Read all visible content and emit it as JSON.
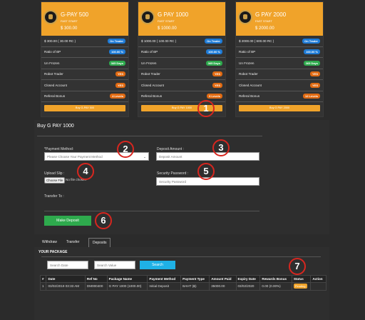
{
  "cards": [
    {
      "title": "G-PAY 500",
      "subtitle": "FAST START",
      "price": "$ 300.00",
      "rows": [
        {
          "label": "$ 300.00 ( 30.00 RC )",
          "badge": "On Trader",
          "color": "b-blue"
        },
        {
          "label": "Ratio of BP",
          "badge": "100.00 %",
          "color": "b-blue"
        },
        {
          "label": "Un Frozen",
          "badge": "365 Days",
          "color": "b-green"
        },
        {
          "label": "Robot Trader",
          "badge": "YES",
          "color": "b-orange"
        },
        {
          "label": "Closed Account",
          "badge": "YES",
          "color": "b-orange"
        },
        {
          "label": "Referal Bonus",
          "badge": "4 Levels",
          "color": "b-orange"
        }
      ],
      "buy": "Buy G-PAY 500"
    },
    {
      "title": "G PAY 1000",
      "subtitle": "FAST START",
      "price": "$ 1000.00",
      "rows": [
        {
          "label": "$ 1000.00 ( 100.00 RC )",
          "badge": "On Trader",
          "color": "b-blue"
        },
        {
          "label": "Ratio of BP",
          "badge": "100.00 %",
          "color": "b-blue"
        },
        {
          "label": "Un Frozen",
          "badge": "365 Days",
          "color": "b-green"
        },
        {
          "label": "Robot Trader",
          "badge": "YES",
          "color": "b-orange"
        },
        {
          "label": "Closed Account",
          "badge": "YES",
          "color": "b-orange"
        },
        {
          "label": "Referal Bonus",
          "badge": "6 Levels",
          "color": "b-orange"
        }
      ],
      "buy": "Buy G PAY 1000"
    },
    {
      "title": "G PAY 2000",
      "subtitle": "FAST START",
      "price": "$ 2000.00",
      "rows": [
        {
          "label": "$ 2000.00 ( 600.00 RC )",
          "badge": "On Trader",
          "color": "b-blue"
        },
        {
          "label": "Ratio of BP",
          "badge": "100.00 %",
          "color": "b-blue"
        },
        {
          "label": "Un Frozen",
          "badge": "365 Days",
          "color": "b-green"
        },
        {
          "label": "Robot Trader",
          "badge": "YES",
          "color": "b-orange"
        },
        {
          "label": "Closed Account",
          "badge": "YES",
          "color": "b-orange"
        },
        {
          "label": "Referal Bonus",
          "badge": "12 Levels",
          "color": "b-orange"
        }
      ],
      "buy": "Buy G PAY 2000"
    }
  ],
  "form": {
    "heading": "Buy G PAY 1000",
    "payment_label": "*Payment Method:",
    "payment_value": "Please Choose Your Payment Method",
    "deposit_label": "Deposit Amount :",
    "deposit_placeholder": "Deposit Amount",
    "upload_label": "Upload Slip :",
    "choose_file": "Choose File",
    "no_file": "No file chosen",
    "security_label": "Security Password :",
    "security_placeholder": "Security Password",
    "transfer_label": "Transfer To :",
    "submit": "Make Deposit"
  },
  "tabs": [
    "Withdraw",
    "Transfer",
    "Deposits"
  ],
  "package": {
    "title": "YOUR PACKAGE",
    "search_date": "Search Date",
    "search_value": "Search Value",
    "search_button": "Search",
    "headers": [
      "#",
      "Date",
      "Ref No",
      "Package Name",
      "Payment Method",
      "Payment Type",
      "Amount Paid",
      "Expiry Date",
      "Rewards Bonus",
      "Status",
      "Action"
    ],
    "row": [
      "1",
      "03/02/2019 03:33 AM",
      "DM000400",
      "G PAY 1000 (1000.00)",
      "Initial Deposit",
      "BAHT (฿)",
      "35000.00",
      "03/02/2020",
      "0.00 (0.00%)",
      "Pending",
      ""
    ]
  },
  "annotations": [
    "1",
    "2",
    "3",
    "4",
    "5",
    "6",
    "7"
  ],
  "colors": {
    "accent": "#f0a32a",
    "annotation": "#d8261f",
    "search": "#1fb1e6",
    "submit": "#2eaa4d"
  }
}
